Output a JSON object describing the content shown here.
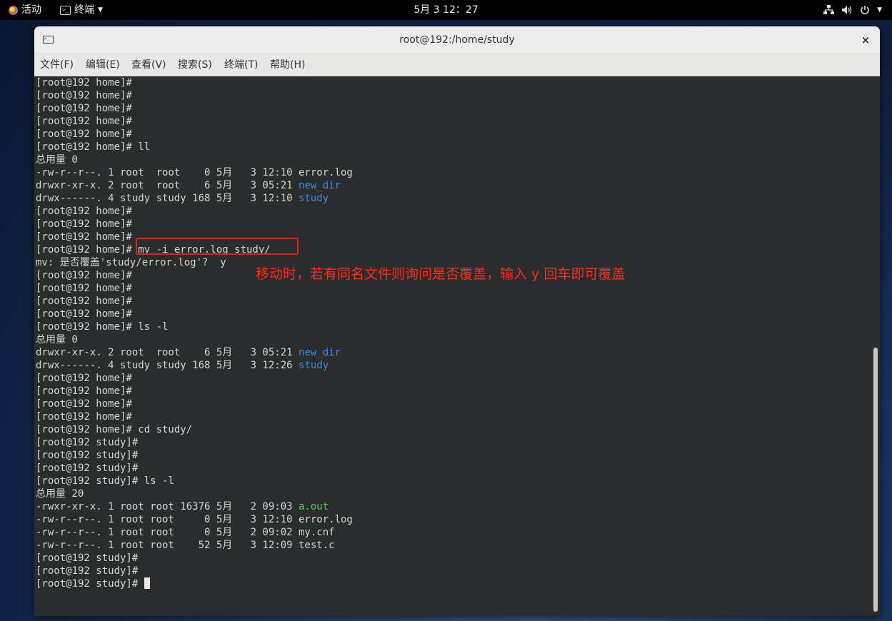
{
  "topbar": {
    "activities": "活动",
    "app_menu": "终端",
    "clock": "5月 3  12：27"
  },
  "window": {
    "title": "root@192:/home/study",
    "close": "×"
  },
  "menubar": [
    {
      "label": "文件(F)",
      "name": "menu-file"
    },
    {
      "label": "编辑(E)",
      "name": "menu-edit"
    },
    {
      "label": "查看(V)",
      "name": "menu-view"
    },
    {
      "label": "搜索(S)",
      "name": "menu-search"
    },
    {
      "label": "终端(T)",
      "name": "menu-terminal"
    },
    {
      "label": "帮助(H)",
      "name": "menu-help"
    }
  ],
  "terminal_lines": [
    [
      {
        "t": "[root@192 home]#"
      }
    ],
    [
      {
        "t": "[root@192 home]#"
      }
    ],
    [
      {
        "t": "[root@192 home]#"
      }
    ],
    [
      {
        "t": "[root@192 home]#"
      }
    ],
    [
      {
        "t": "[root@192 home]#"
      }
    ],
    [
      {
        "t": "[root@192 home]# ll"
      }
    ],
    [
      {
        "t": "总用量 0"
      }
    ],
    [
      {
        "t": "-rw-r--r--. 1 root  root    0 5月   3 12:10 error.log"
      }
    ],
    [
      {
        "t": "drwxr-xr-x. 2 root  root    6 5月   3 05:21 "
      },
      {
        "t": "new_dir",
        "c": "blue"
      }
    ],
    [
      {
        "t": "drwx------. 4 study study 168 5月   3 12:10 "
      },
      {
        "t": "study",
        "c": "blue"
      }
    ],
    [
      {
        "t": "[root@192 home]#"
      }
    ],
    [
      {
        "t": "[root@192 home]#"
      }
    ],
    [
      {
        "t": "[root@192 home]#"
      }
    ],
    [
      {
        "t": "[root@192 home]# mv -i error.log study/"
      }
    ],
    [
      {
        "t": "mv: 是否覆盖'study/error.log'?  y"
      }
    ],
    [
      {
        "t": "[root@192 home]#"
      }
    ],
    [
      {
        "t": "[root@192 home]#"
      }
    ],
    [
      {
        "t": "[root@192 home]#"
      }
    ],
    [
      {
        "t": "[root@192 home]#"
      }
    ],
    [
      {
        "t": "[root@192 home]# ls -l"
      }
    ],
    [
      {
        "t": "总用量 0"
      }
    ],
    [
      {
        "t": "drwxr-xr-x. 2 root  root    6 5月   3 05:21 "
      },
      {
        "t": "new_dir",
        "c": "blue"
      }
    ],
    [
      {
        "t": "drwx------. 4 study study 168 5月   3 12:26 "
      },
      {
        "t": "study",
        "c": "blue"
      }
    ],
    [
      {
        "t": "[root@192 home]#"
      }
    ],
    [
      {
        "t": "[root@192 home]#"
      }
    ],
    [
      {
        "t": "[root@192 home]#"
      }
    ],
    [
      {
        "t": "[root@192 home]#"
      }
    ],
    [
      {
        "t": "[root@192 home]# cd study/"
      }
    ],
    [
      {
        "t": "[root@192 study]#"
      }
    ],
    [
      {
        "t": "[root@192 study]#"
      }
    ],
    [
      {
        "t": "[root@192 study]#"
      }
    ],
    [
      {
        "t": "[root@192 study]# ls -l"
      }
    ],
    [
      {
        "t": "总用量 20"
      }
    ],
    [
      {
        "t": "-rwxr-xr-x. 1 root root 16376 5月   2 09:03 "
      },
      {
        "t": "a.out",
        "c": "green"
      }
    ],
    [
      {
        "t": "-rw-r--r--. 1 root root     0 5月   3 12:10 error.log"
      }
    ],
    [
      {
        "t": "-rw-r--r--. 1 root root     0 5月   2 09:02 my.cnf"
      }
    ],
    [
      {
        "t": "-rw-r--r--. 1 root root    52 5月   3 12:09 test.c"
      }
    ],
    [
      {
        "t": "[root@192 study]#"
      }
    ],
    [
      {
        "t": "[root@192 study]#"
      }
    ],
    [
      {
        "t": "[root@192 study]# "
      },
      {
        "cursor": true
      }
    ]
  ],
  "annotation": {
    "text": "移动时，若有同名文件则询问是否覆盖，输入 y 回车即可覆盖",
    "color": "#ff2a1a"
  },
  "colors": {
    "dir_blue": "#3a8ee6",
    "exec_green": "#4bd33a",
    "terminal_bg": "#2a2c2e"
  }
}
